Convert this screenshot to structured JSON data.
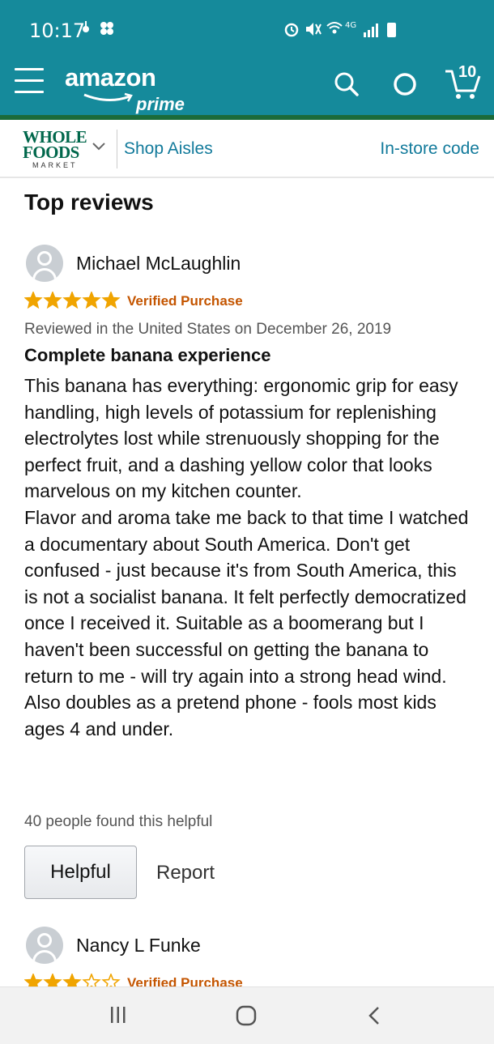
{
  "status_bar": {
    "time": "10:17",
    "network": "4G"
  },
  "app_header": {
    "logo_text": "amazon",
    "logo_sub": "prime",
    "cart_count": "10",
    "icons": [
      "menu-icon",
      "search-icon",
      "alexa-icon",
      "cart-icon"
    ],
    "background_color": "#158a9b"
  },
  "subnav": {
    "brand_line1": "WHOLE",
    "brand_line2": "FOODS",
    "brand_line3": "MARKET",
    "shop_aisles": "Shop Aisles",
    "instore_code": "In-store code",
    "link_color": "#127a9b"
  },
  "reviews_section": {
    "title": "Top reviews",
    "reviews": [
      {
        "reviewer": "Michael McLaughlin",
        "rating": 5,
        "max_rating": 5,
        "badge": "Verified Purchase",
        "date_line": "Reviewed in the United States on December 26, 2019",
        "title": "Complete banana experience",
        "body": "This banana has everything: ergonomic grip for easy handling, high levels of potassium for replenishing electrolytes lost while strenuously shopping for the perfect fruit, and a dashing yellow color that looks marvelous on my kitchen counter.\nFlavor and aroma take me back to that time I watched a documentary about South America. Don't get confused - just because it's from South America, this is not a socialist banana. It felt perfectly democratized once I received it. Suitable as a boomerang but I haven't been successful on getting the banana to return to me - will try again into a strong head wind. Also doubles as a pretend phone - fools most kids ages 4 and under.",
        "helpful_count": "40 people found this helpful",
        "helpful_button": "Helpful",
        "report_link": "Report"
      },
      {
        "reviewer": "Nancy L Funke",
        "rating": 3,
        "max_rating": 5,
        "badge": "Verified Purchase"
      }
    ]
  },
  "colors": {
    "star": "#f0a400",
    "verified": "#c45500"
  }
}
